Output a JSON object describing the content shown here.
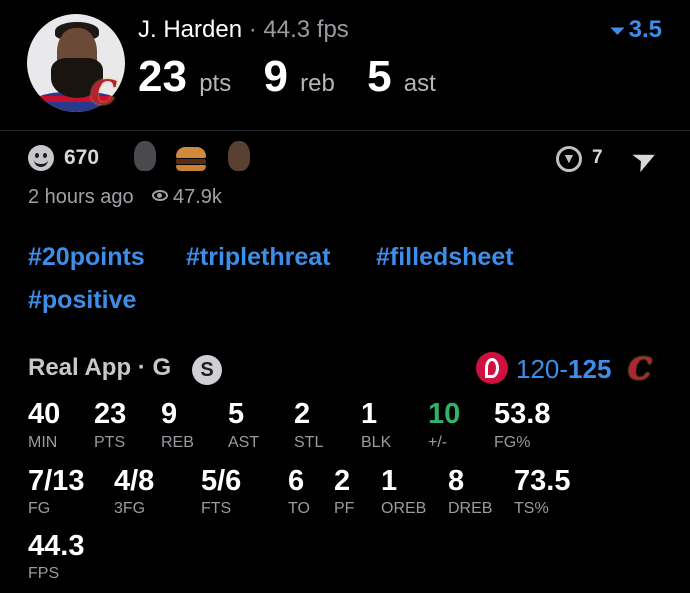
{
  "header": {
    "player_name": "J. Harden",
    "separator": "·",
    "fps_label": "44.3 fps",
    "points": "23",
    "points_unit": "pts",
    "rebounds": "9",
    "rebounds_unit": "reb",
    "assists": "5",
    "assists_unit": "ast",
    "line_value": "3.5",
    "accent_color": "#3d8ee8"
  },
  "team_badge": "C",
  "reactions": {
    "count": "670",
    "shield_count": "7"
  },
  "meta": {
    "time_ago": "2 hours ago",
    "views": "47.9k"
  },
  "hashtags": [
    "#20points",
    "#triplethreat",
    "#filledsheet",
    "#positive"
  ],
  "game": {
    "title": "Real App · G",
    "badge": "S",
    "score_left": "120-",
    "score_right": "125",
    "away_team_icon": "raptors-icon",
    "home_team_badge": "C"
  },
  "stats": {
    "row1": [
      {
        "value": "40",
        "label": "MIN"
      },
      {
        "value": "23",
        "label": "PTS"
      },
      {
        "value": "9",
        "label": "REB"
      },
      {
        "value": "5",
        "label": "AST"
      },
      {
        "value": "2",
        "label": "STL"
      },
      {
        "value": "1",
        "label": "BLK"
      },
      {
        "value": "10",
        "label": "+/-"
      },
      {
        "value": "53.8",
        "label": "FG%"
      }
    ],
    "row2": [
      {
        "value": "7/13",
        "label": "FG"
      },
      {
        "value": "4/8",
        "label": "3FG"
      },
      {
        "value": "5/6",
        "label": "FTS"
      },
      {
        "value": "6",
        "label": "TO"
      },
      {
        "value": "2",
        "label": "PF"
      },
      {
        "value": "1",
        "label": "OREB"
      },
      {
        "value": "8",
        "label": "DREB"
      },
      {
        "value": "73.5",
        "label": "TS%"
      }
    ],
    "row3": [
      {
        "value": "44.3",
        "label": "FPS"
      }
    ],
    "positive_color": "#2fb36b"
  }
}
